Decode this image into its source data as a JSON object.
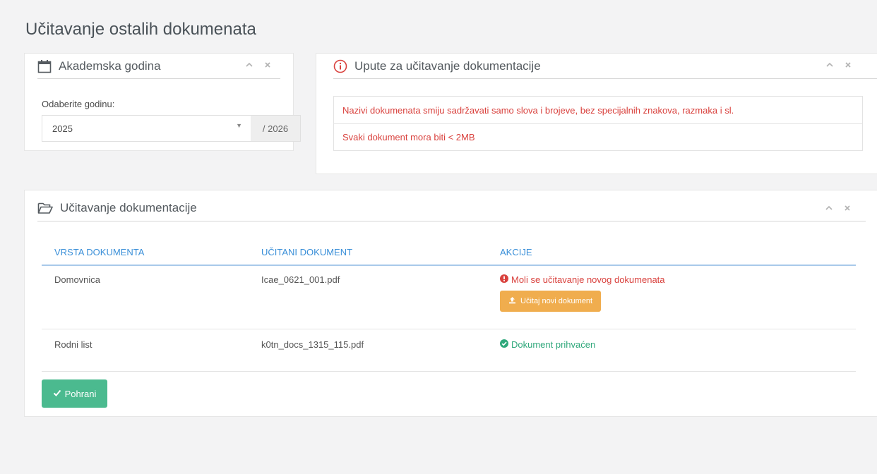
{
  "page": {
    "title": "Učitavanje ostalih dokumenata"
  },
  "year_panel": {
    "title": "Akademska godina",
    "field_label": "Odaberite godinu:",
    "selected_year": "2025",
    "end_year": "/ 2026"
  },
  "instructions_panel": {
    "title": "Upute za učitavanje dokumentacije",
    "items": [
      "Nazivi dokumenata smiju sadržavati samo slova i brojeve, bez specijalnih znakova, razmaka i sl.",
      "Svaki dokument mora biti < 2MB"
    ]
  },
  "upload_panel": {
    "title": "Učitavanje dokumentacije",
    "columns": [
      "VRSTA DOKUMENTA",
      "UČITANI DOKUMENT",
      "AKCIJE"
    ],
    "rows": [
      {
        "type": "Domovnica",
        "file": "Icae_0621_001.pdf",
        "status": "Moli se učitavanje novog dokumenata",
        "action_label": "Učitaj novi dokument"
      },
      {
        "type": "Rodni list",
        "file": "k0tn_docs_1315_115.pdf",
        "status": "Dokument prihvaćen"
      }
    ],
    "save_label": "Pohrani"
  },
  "colors": {
    "warning": "#d9413d",
    "success": "#2fa87b",
    "upload_button": "#f0ad4e",
    "save_button": "#4bba8f",
    "table_header": "#3a8fd8"
  },
  "icons": {
    "year_panel": "calendar-icon",
    "instructions_panel": "info-circle-icon",
    "upload_panel": "folder-open-icon",
    "collapse": "chevron-up-icon",
    "close": "close-icon",
    "warning": "exclamation-circle-icon",
    "success": "check-circle-icon",
    "upload": "upload-icon",
    "save": "check-icon"
  }
}
